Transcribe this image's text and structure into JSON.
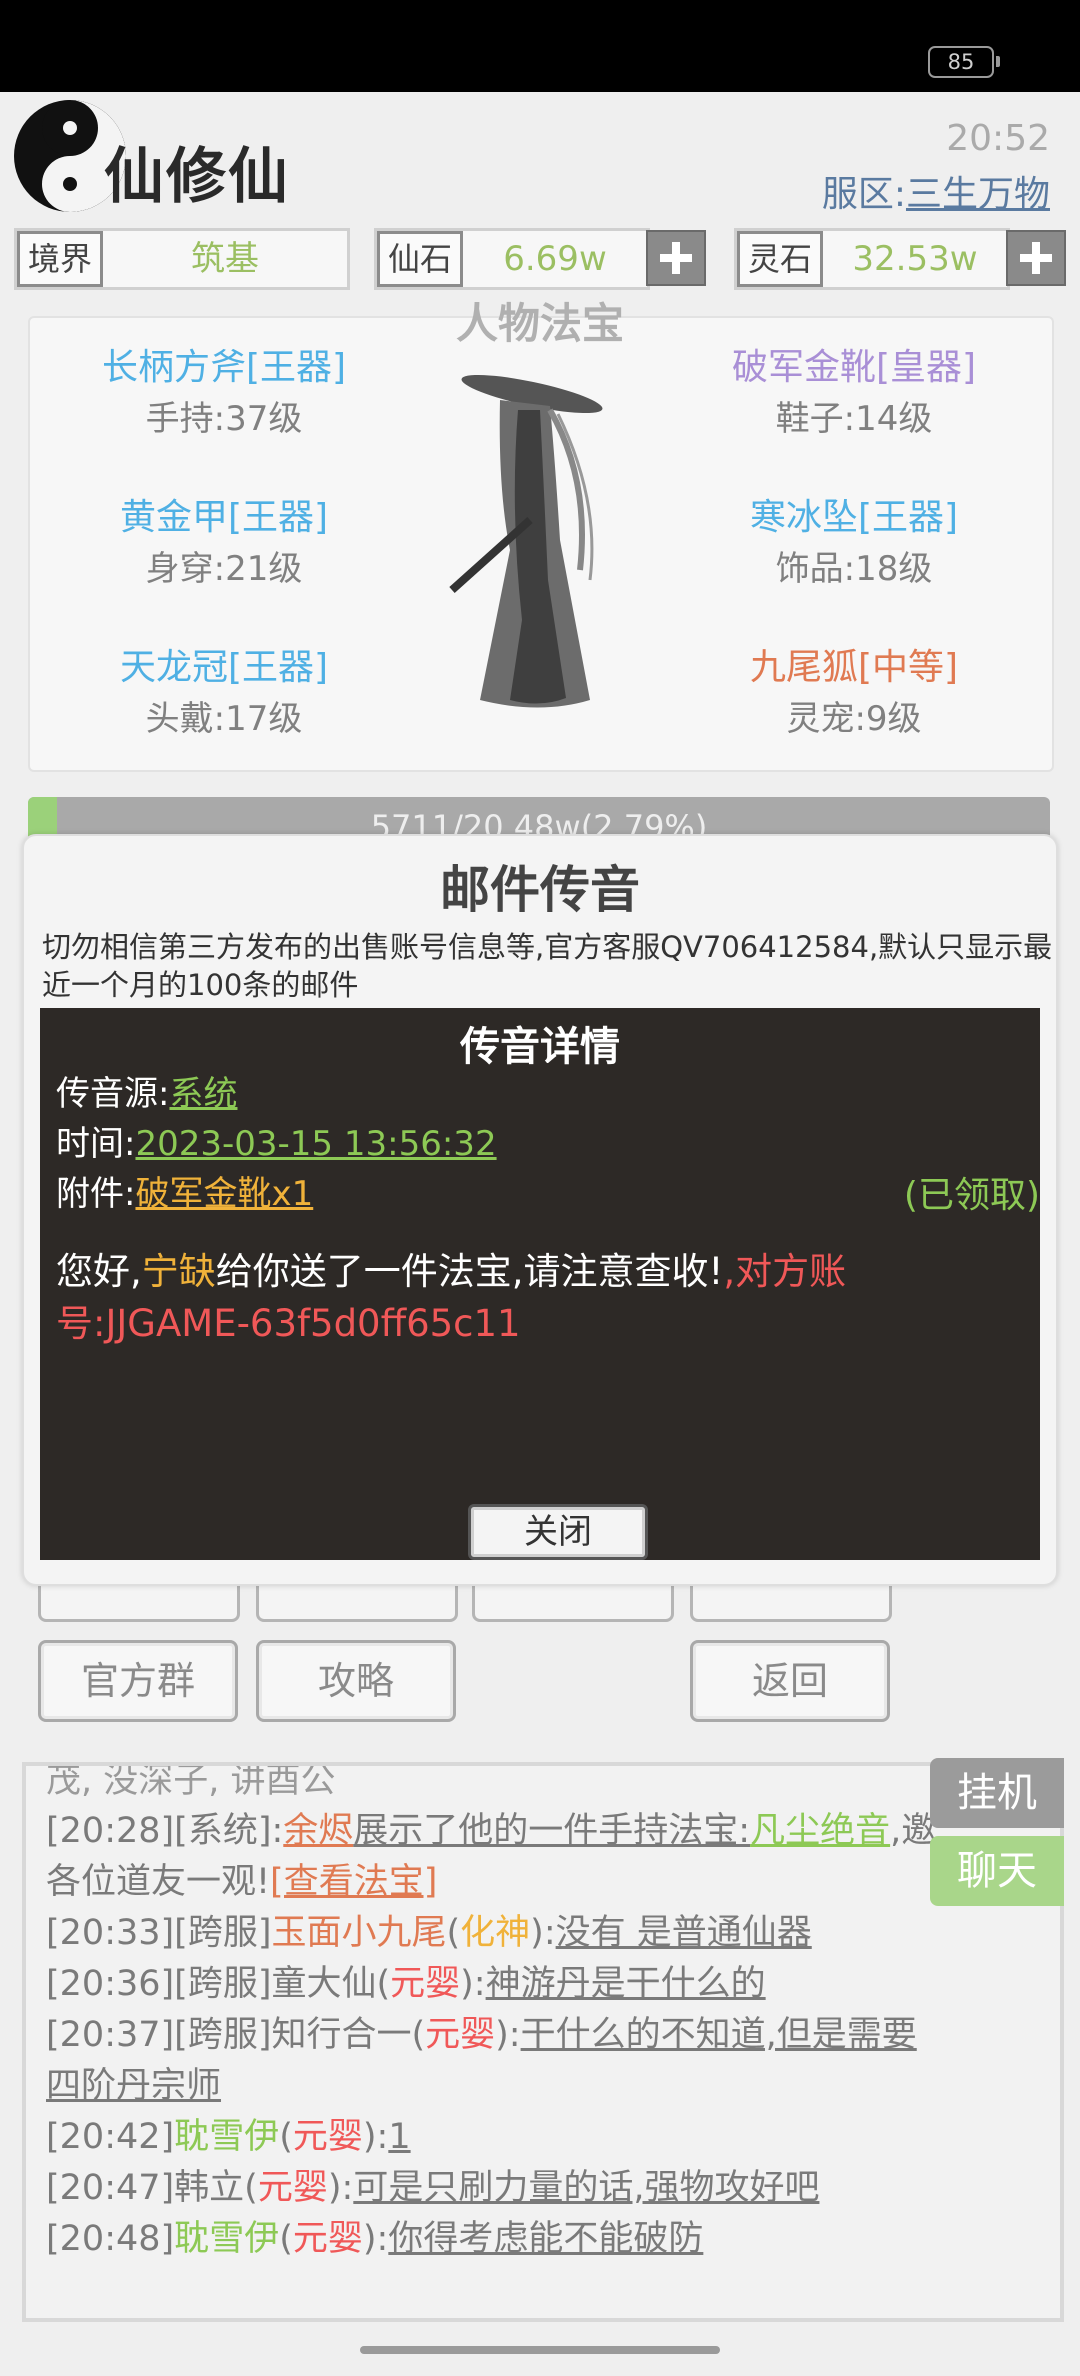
{
  "status_bar": {
    "battery": "85"
  },
  "header": {
    "app_title": "仙修仙",
    "time": "20:52",
    "server_label": "服区:",
    "server_name": "三生万物"
  },
  "stats": [
    {
      "label": "境界",
      "value": "筑基"
    },
    {
      "label": "仙石",
      "value": "6.69w"
    },
    {
      "label": "灵石",
      "value": "32.53w"
    }
  ],
  "equipment": {
    "title": "人物法宝",
    "items": [
      {
        "name": "长柄方斧[王器]",
        "slot": "手持:37级",
        "color": "#4fb0e4"
      },
      {
        "name": "破军金靴[皇器]",
        "slot": "鞋子:14级",
        "color": "#a98fd6"
      },
      {
        "name": "黄金甲[王器]",
        "slot": "身穿:21级",
        "color": "#4fb0e4"
      },
      {
        "name": "寒冰坠[王器]",
        "slot": "饰品:18级",
        "color": "#4fb0e4"
      },
      {
        "name": "天龙冠[王器]",
        "slot": "头戴:17级",
        "color": "#4fb0e4"
      },
      {
        "name": "九尾狐[中等]",
        "slot": "灵宠:9级",
        "color": "#e07a52"
      }
    ]
  },
  "progress": {
    "text": "5711/20.48w(2.79%)",
    "fraction": 0.0279
  },
  "buttons": {
    "official_group": "官方群",
    "guide": "攻略",
    "back": "返回"
  },
  "mail_modal": {
    "title": "邮件传音",
    "description": "切勿相信第三方发布的出售账号信息等,官方客服QV706412584,默认只显示最近一个月的100条的邮件",
    "detail_title": "传音详情",
    "source_label": "传音源:",
    "source_value": "系统",
    "time_label": "时间:",
    "time_value": "2023-03-15 13:56:32",
    "attachment_label": "附件:",
    "attachment_value": "破军金靴x1",
    "claimed": "(已领取)",
    "message_part1": "您好,",
    "sender": "宁缺",
    "message_part2": "给你送了一件法宝,请注意查收!",
    "message_part3": ",对方账号:JJGAME-63f5d0ff65c11",
    "close_button": "关闭"
  },
  "chat": {
    "lines": [
      {
        "a": "[20:28][系统]:",
        "b": "余烬",
        "c": "展示了他的一件手持法宝:",
        "d": "凡尘绝音",
        "e": ",邀"
      },
      {
        "a": "各位道友一观!",
        "b": "[查看法宝]"
      },
      {
        "a": "[20:33][跨服]",
        "b": "玉面小九尾",
        "c": "(",
        "d": "化神",
        "e": "):",
        "f": "没有 是普通仙器"
      },
      {
        "a": "[20:36][跨服]童大仙(",
        "b": "元婴",
        "c": "):",
        "d": "神游丹是干什么的"
      },
      {
        "a": "[20:37][跨服]知行合一(",
        "b": "元婴",
        "c": "):",
        "d": "干什么的不知道,但是需要"
      },
      {
        "a": "四阶丹宗师"
      },
      {
        "a": "[20:42]",
        "b": "耽雪伊",
        "c": "(",
        "d": "元婴",
        "e": "):",
        "f": "1"
      },
      {
        "a": "[20:47]韩立(",
        "b": "元婴",
        "c": "):",
        "d": "可是只刷力量的话,强物攻好吧"
      },
      {
        "a": "[20:48]",
        "b": "耽雪伊",
        "c": "(",
        "d": "元婴",
        "e": "):",
        "f": "你得考虑能不能破防"
      }
    ]
  },
  "side_buttons": {
    "idle": "挂机",
    "chat": "聊天"
  }
}
